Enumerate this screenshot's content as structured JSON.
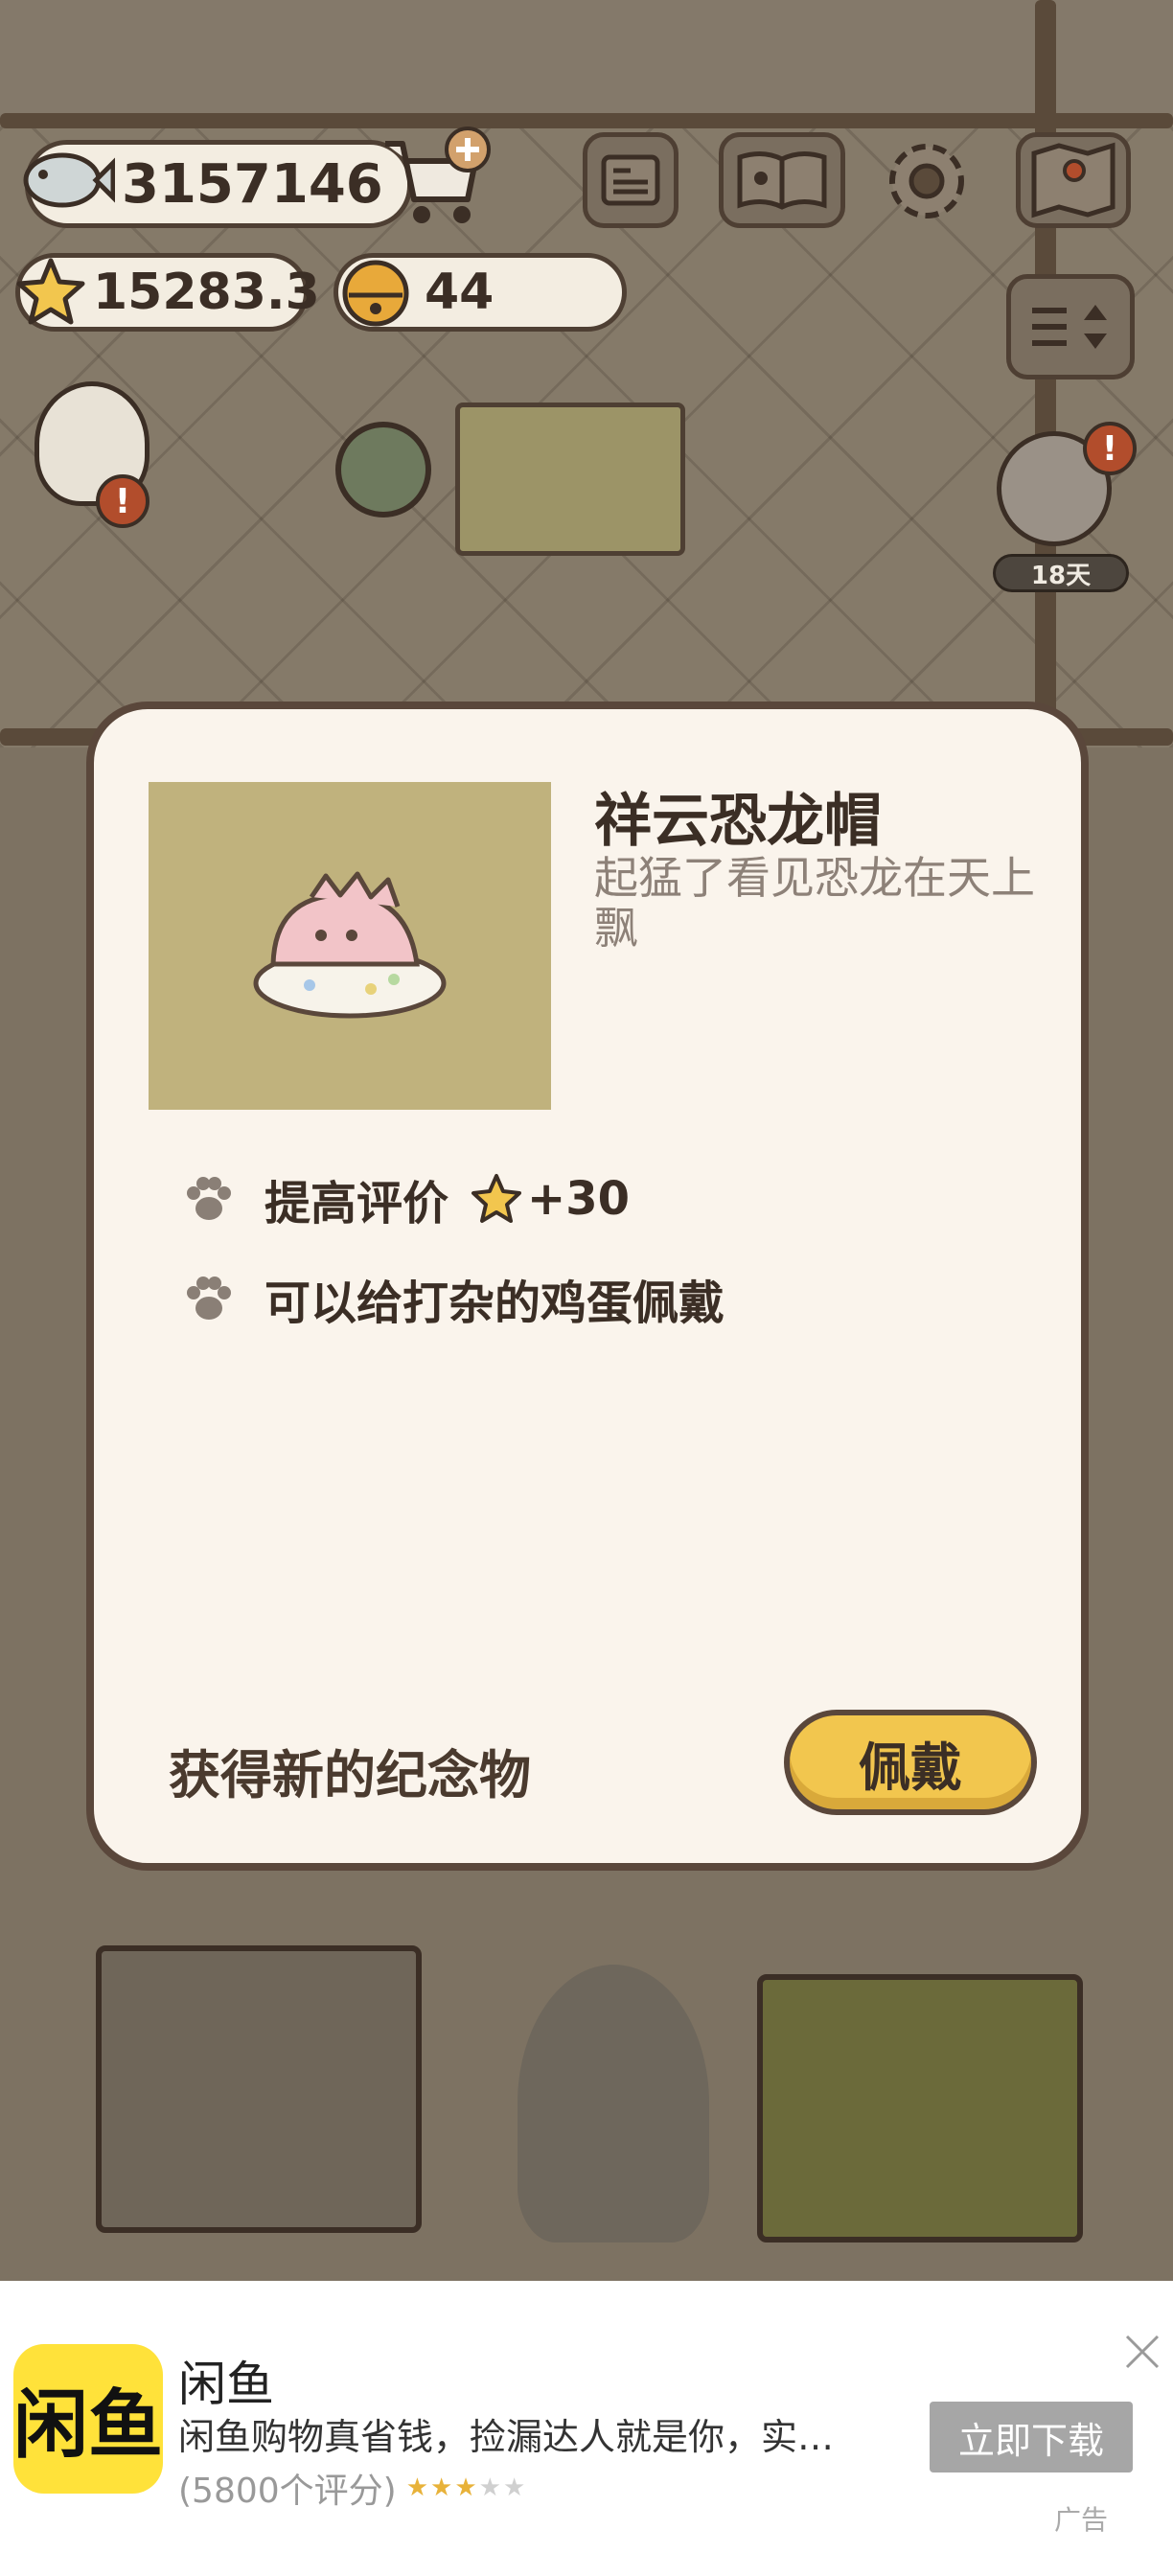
{
  "hud": {
    "fish_currency": "3157146",
    "star_rating": "15283.3",
    "bell_currency": "44",
    "calendar_days": "18天"
  },
  "icons": {
    "fish": "fish-icon",
    "shop": "shop-cart-plus-icon",
    "star": "star-icon",
    "bell": "bell-icon",
    "news": "newspaper-icon",
    "book": "paw-book-icon",
    "settings": "gear-icon",
    "map": "map-icon",
    "sort": "sort-toggle-icon",
    "alert": "alert-badge-icon",
    "paw": "paw-icon",
    "close": "close-icon"
  },
  "modal": {
    "title": "祥云恐龙帽",
    "description": "起猛了看见恐龙在天上飘",
    "effects": [
      {
        "text": "提高评价",
        "bonus": "+30"
      },
      {
        "text": "可以给打杂的鸡蛋佩戴"
      }
    ],
    "footer": "获得新的纪念物",
    "wear_button": "佩戴"
  },
  "ad": {
    "logo_text": "闲鱼",
    "app_name": "闲鱼",
    "description": "闲鱼购物真省钱，捡漏达人就是你，实惠…",
    "rating_count": "(5800个评分)",
    "stars": "★★★★★",
    "rating_value": 3,
    "download_button": "立即下载",
    "ad_label": "广告"
  },
  "colors": {
    "modal_bg": "#faf4ec",
    "modal_border": "#5a473b",
    "item_bg": "#c0b27d",
    "button": "#f2c64e",
    "ad_logo": "#ffe23a"
  }
}
